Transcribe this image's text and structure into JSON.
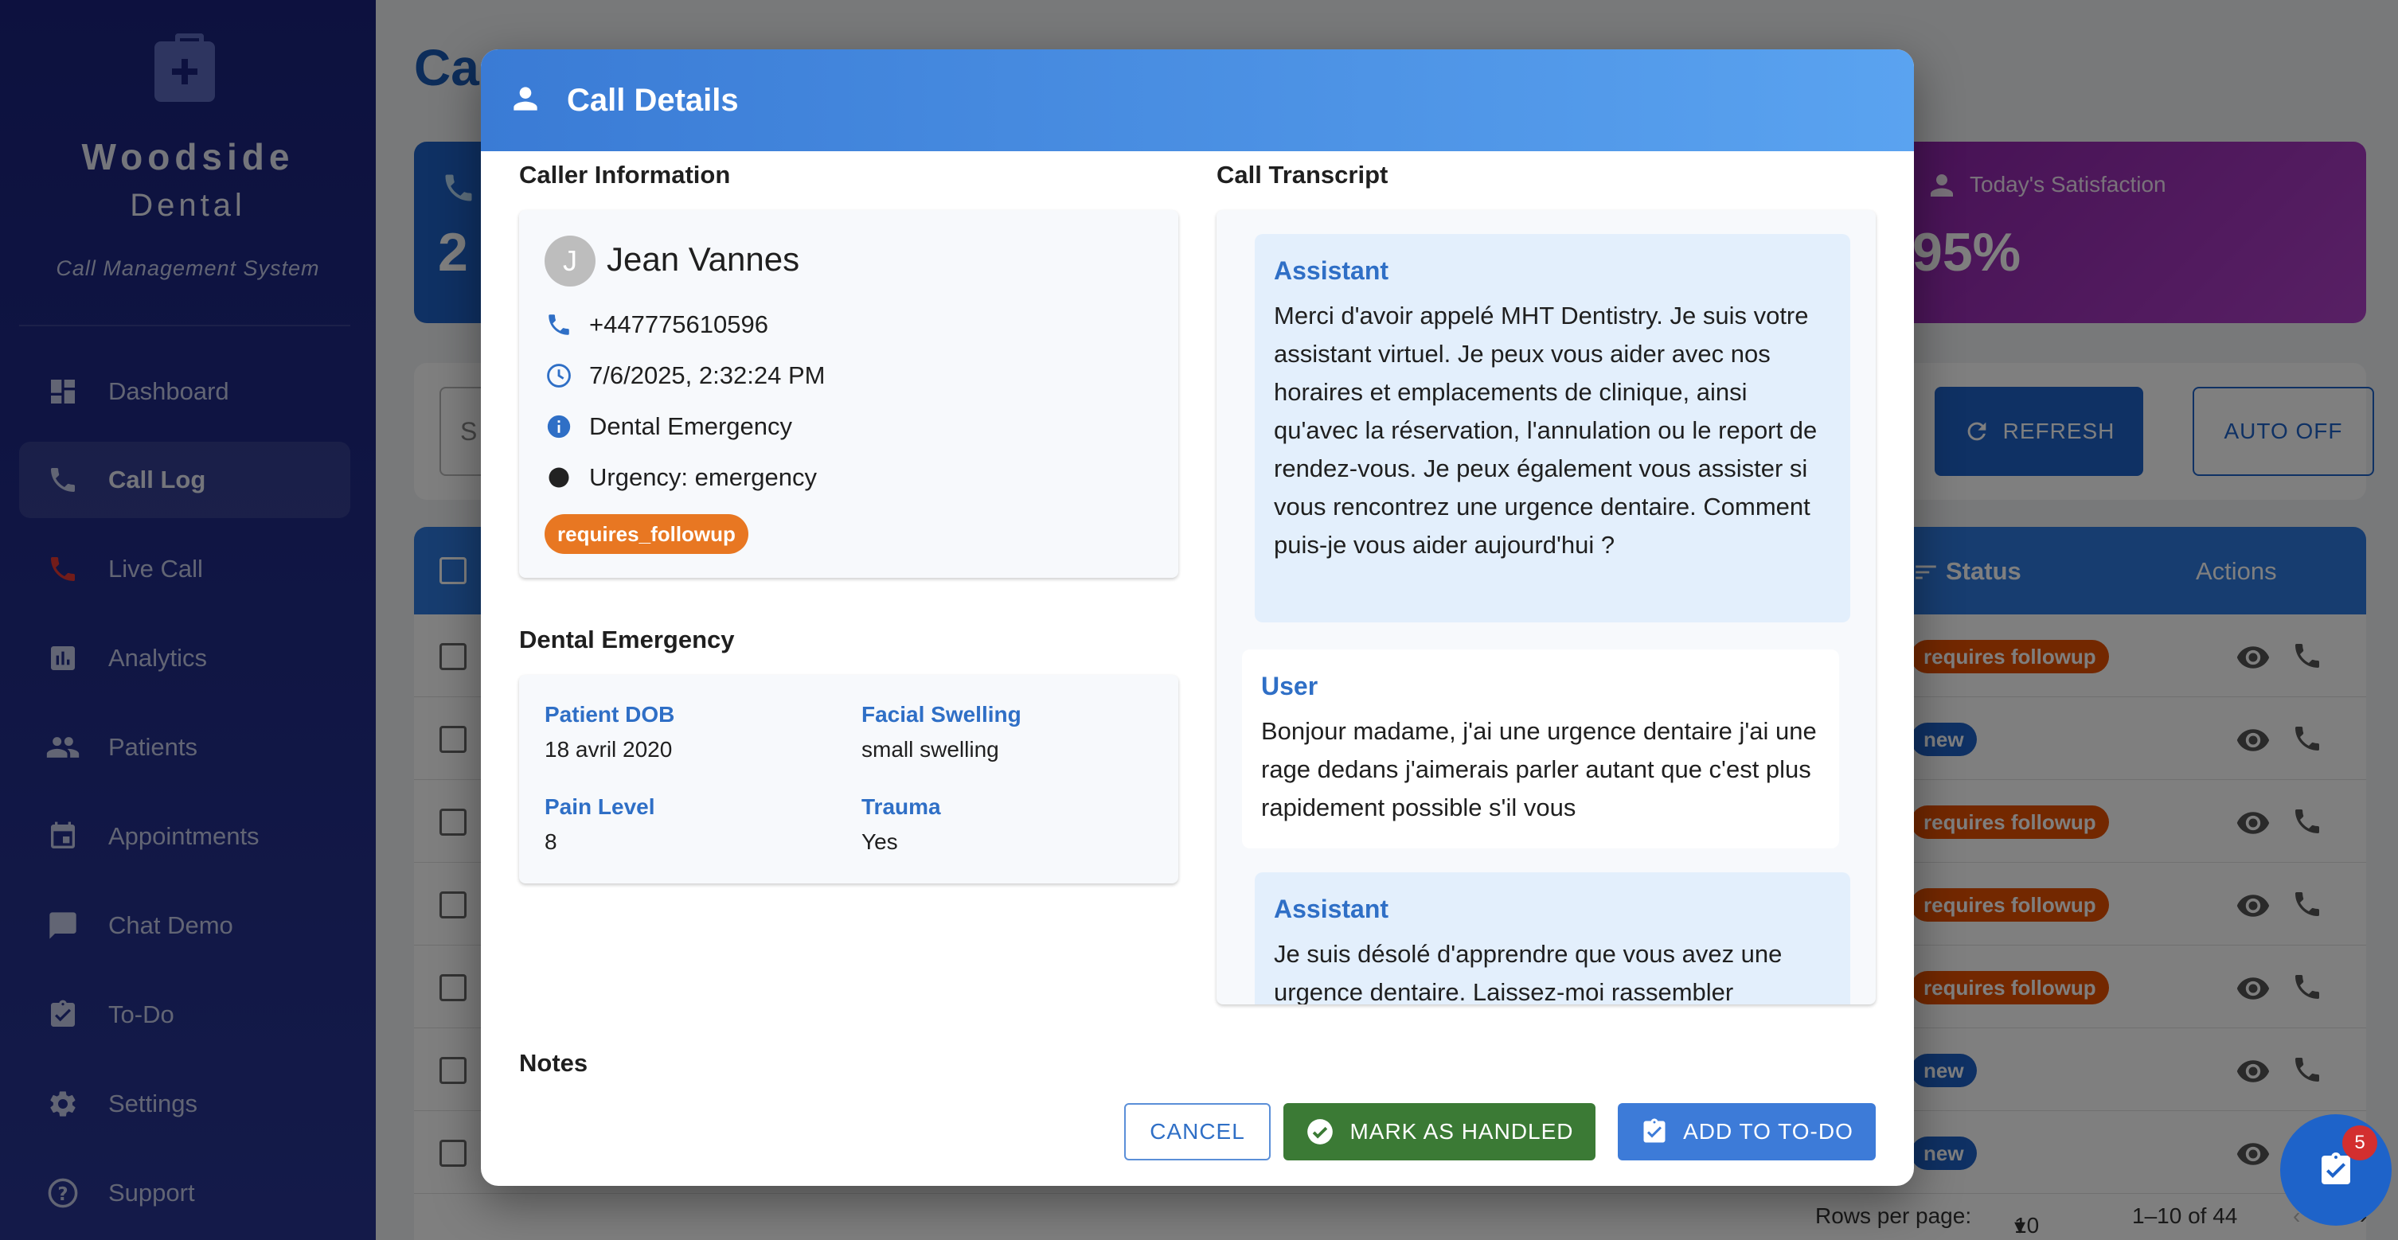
{
  "sidebar": {
    "brand_name": "Woodside",
    "brand_sub": "Dental",
    "brand_tagline": "Call Management System",
    "items": [
      {
        "label": "Dashboard",
        "icon": "dashboard-icon"
      },
      {
        "label": "Call Log",
        "icon": "phone-icon",
        "active": true
      },
      {
        "label": "Live Call",
        "icon": "phone-red-icon"
      },
      {
        "label": "Analytics",
        "icon": "analytics-icon"
      },
      {
        "label": "Patients",
        "icon": "people-icon"
      },
      {
        "label": "Appointments",
        "icon": "calendar-icon"
      },
      {
        "label": "Chat Demo",
        "icon": "chat-icon"
      },
      {
        "label": "To-Do",
        "icon": "clipboard-check-icon"
      },
      {
        "label": "Settings",
        "icon": "gear-icon"
      },
      {
        "label": "Support",
        "icon": "help-icon"
      }
    ]
  },
  "page": {
    "title_partial": "Ca",
    "stat_blue_value": "2",
    "stat_purple_label": "Today's Satisfaction",
    "stat_purple_value": "95%",
    "search_partial": "S",
    "refresh_label": "REFRESH",
    "auto_label": "AUTO OFF",
    "table": {
      "col_status": "Status",
      "col_actions": "Actions",
      "rows": [
        {
          "status": "requires followup",
          "kind": "orange"
        },
        {
          "status": "new",
          "kind": "blue"
        },
        {
          "status": "requires followup",
          "kind": "orange"
        },
        {
          "status": "requires followup",
          "kind": "orange"
        },
        {
          "status": "requires followup",
          "kind": "orange"
        },
        {
          "status": "new",
          "kind": "blue"
        },
        {
          "status": "new",
          "kind": "blue"
        }
      ]
    },
    "pager": {
      "rows_label": "Rows per page:",
      "rows_value": "10",
      "range": "1–10 of 44"
    },
    "fab_badge": "5"
  },
  "dialog": {
    "title": "Call Details",
    "caller_section": "Caller Information",
    "caller": {
      "initial": "J",
      "name": "Jean Vannes",
      "phone": "+447775610596",
      "datetime": "7/6/2025, 2:32:24 PM",
      "reason": "Dental Emergency",
      "urgency": "Urgency: emergency",
      "tag": "requires_followup"
    },
    "emergency_section": "Dental Emergency",
    "emergency": {
      "dob_label": "Patient DOB",
      "dob_value": "18 avril 2020",
      "swelling_label": "Facial Swelling",
      "swelling_value": "small swelling",
      "pain_label": "Pain Level",
      "pain_value": "8",
      "trauma_label": "Trauma",
      "trauma_value": "Yes"
    },
    "notes_section": "Notes",
    "transcript_section": "Call Transcript",
    "transcript": [
      {
        "role": "Assistant",
        "text": "Merci d'avoir appelé MHT Dentistry. Je suis votre assistant virtuel. Je peux vous aider avec nos horaires et emplacements de clinique, ainsi qu'avec la réservation, l'annulation ou le report de rendez-vous. Je peux également vous assister si vous rencontrez une urgence dentaire. Comment puis-je vous aider aujourd'hui ?"
      },
      {
        "role": "User",
        "text": "Bonjour madame, j'ai une urgence dentaire j'ai une rage dedans j'aimerais parler autant que c'est plus rapidement possible s'il vous"
      },
      {
        "role": "Assistant",
        "text": "Je suis désolé d'apprendre que vous avez une urgence dentaire. Laissez-moi rassembler"
      }
    ],
    "buttons": {
      "cancel": "CANCEL",
      "handled": "MARK AS HANDLED",
      "todo": "ADD TO TO-DO"
    }
  },
  "colors": {
    "sidebar": "#1a237e",
    "primary": "#3a7bd5",
    "success": "#3b7a35",
    "tag": "#e87722"
  }
}
